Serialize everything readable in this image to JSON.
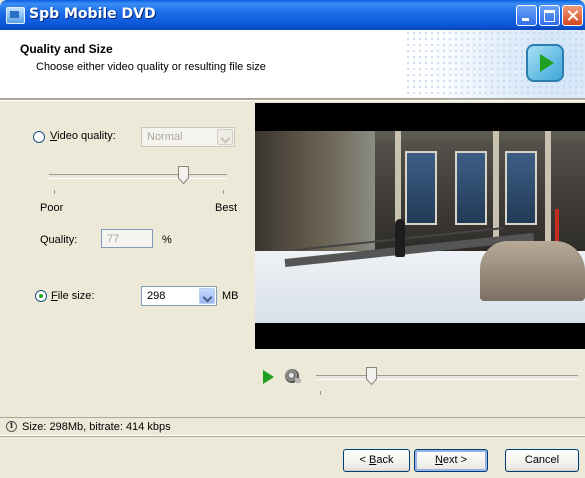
{
  "window": {
    "title": "Spb Mobile DVD"
  },
  "header": {
    "title": "Quality and Size",
    "subtitle": "Choose either video quality or resulting file size"
  },
  "video_quality": {
    "label_prefix": "",
    "label_accel": "V",
    "label_rest": "ideo quality:",
    "selected": false,
    "combo_value": "Normal",
    "slider_min_label": "Poor",
    "slider_max_label": "Best",
    "slider_level_fraction": 0.75,
    "quality_label": "Quality:",
    "quality_value": "77",
    "quality_unit": "%"
  },
  "file_size": {
    "label_accel": "F",
    "label_rest": "ile size:",
    "selected": true,
    "combo_value": "298",
    "unit": "MB"
  },
  "player": {
    "play_icon": "play-icon",
    "snapshot_icon": "snapshot-icon",
    "seek_fraction": 0.21
  },
  "status": {
    "icon": "info-icon",
    "text": "Size: 298Mb, bitrate: 414 kbps"
  },
  "buttons": {
    "back_prefix": "< ",
    "back_accel": "B",
    "back_rest": "ack",
    "next_accel": "N",
    "next_rest": "ext >",
    "cancel": "Cancel"
  }
}
